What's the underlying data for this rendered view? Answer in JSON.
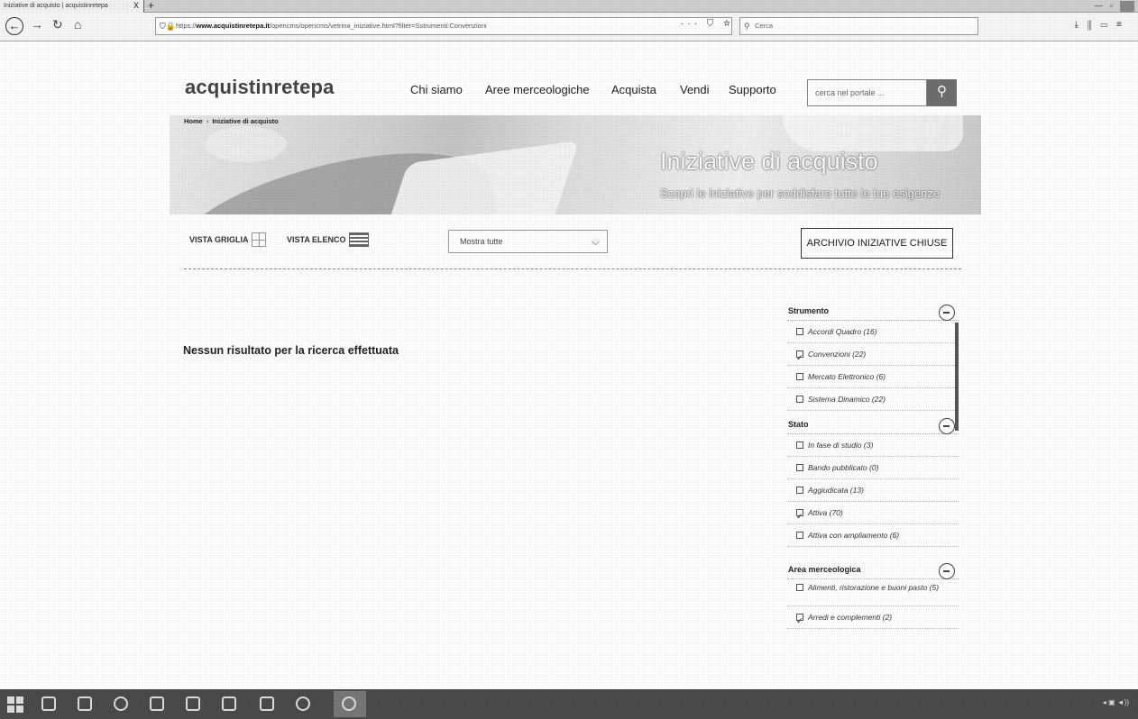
{
  "browser": {
    "tab_title": "Iniziative di acquisto | acquistinretepa",
    "tab_close": "X",
    "new_tab": "+",
    "url_host": "www.acquistinretepa.it",
    "url_rest": "/opencms/opencms/vetrina_iniziative.html?filter=Sstrumenti:Convenzioni",
    "url_prefix": "https://",
    "url_actions": "··· ⛉ ☆",
    "search_placeholder": "Cerca",
    "icons": [
      "back-icon",
      "forward-icon",
      "reload-icon",
      "home-icon",
      "lock-icon",
      "download-icon",
      "library-icon",
      "sidebar-icon",
      "menu-icon"
    ]
  },
  "site": {
    "logo": "acquistinretepa",
    "nav": [
      "Chi siamo",
      "Aree merceologiche",
      "Acquista",
      "Vendi",
      "Supporto"
    ],
    "search_placeholder": "cerca nel portale ...",
    "breadcrumb": [
      "Home",
      "Iniziative di acquisto"
    ],
    "banner_title": "Iniziative di acquisto",
    "banner_subtitle": "Scopri le iniziative per soddisfare tutte le tue esigenze"
  },
  "toolbar": {
    "grid_view": "VISTA GRIGLIA",
    "list_view": "VISTA ELENCO",
    "select_value": "Mostra tutte",
    "archive_button": "ARCHIVIO INIZIATIVE CHIUSE"
  },
  "results": {
    "message": "Nessun risultato per la ricerca effettuata"
  },
  "filters": [
    {
      "title": "Strumento",
      "items": [
        {
          "label": "Accordi Quadro (16)",
          "checked": false
        },
        {
          "label": "Convenzioni (22)",
          "checked": true
        },
        {
          "label": "Mercato Elettronico (6)",
          "checked": false
        },
        {
          "label": "Sistema Dinamico (22)",
          "checked": false
        }
      ]
    },
    {
      "title": "Stato",
      "items": [
        {
          "label": "In fase di studio (3)",
          "checked": false
        },
        {
          "label": "Bando pubblicato (0)",
          "checked": false
        },
        {
          "label": "Aggiudicata (13)",
          "checked": false
        },
        {
          "label": "Attiva (70)",
          "checked": true
        },
        {
          "label": "Attiva con ampliamento (6)",
          "checked": false
        }
      ]
    },
    {
      "title": "Area merceologica",
      "items": [
        {
          "label": "Alimenti, ristorazione e buoni pasto (5)",
          "checked": false
        },
        {
          "label": "Arredi e complementi (2)",
          "checked": true
        }
      ]
    }
  ]
}
